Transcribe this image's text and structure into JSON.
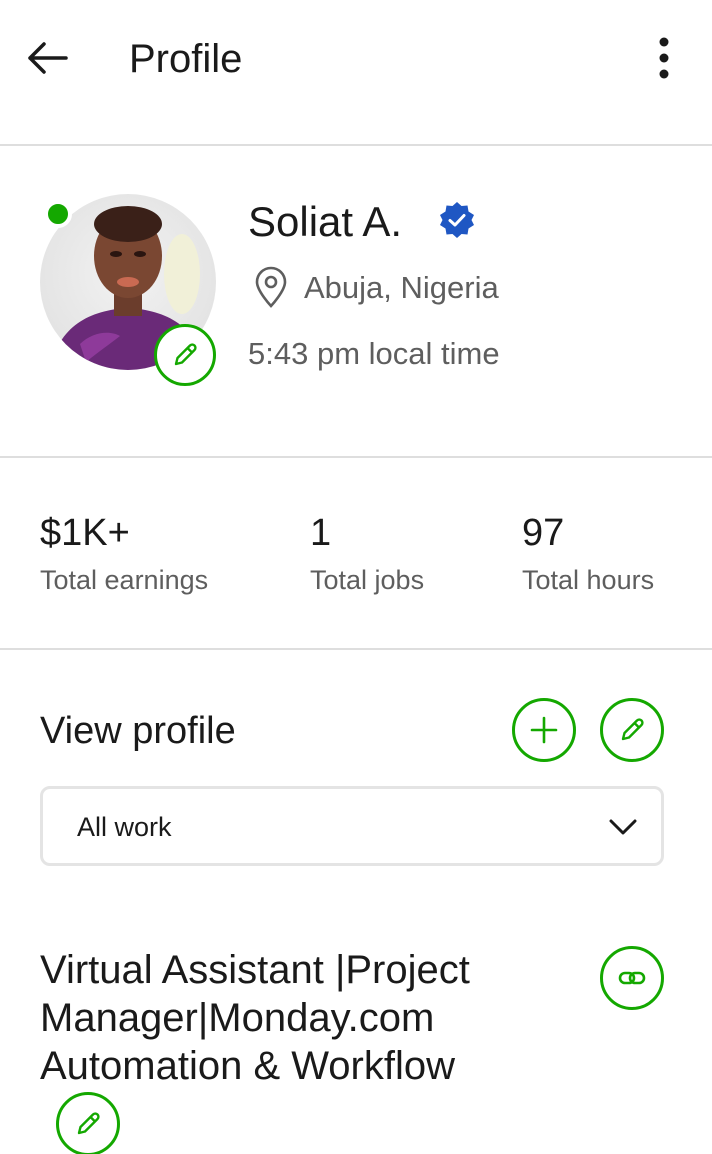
{
  "header": {
    "title": "Profile",
    "back_icon": "arrow-left-icon",
    "menu_icon": "more-vertical-icon"
  },
  "profile": {
    "name": "Soliat A.",
    "verified_icon": "verified-badge-icon",
    "location": "Abuja, Nigeria",
    "local_time": "5:43 pm local time",
    "online": true
  },
  "stats": [
    {
      "value": "$1K+",
      "label": "Total earnings"
    },
    {
      "value": "1",
      "label": "Total jobs"
    },
    {
      "value": "97",
      "label": "Total hours"
    }
  ],
  "view_profile": {
    "label": "View profile",
    "dropdown_value": "All work"
  },
  "headline": "Virtual Assistant |Project Manager|Monday.com Automation & Workflow",
  "colors": {
    "accent": "#14a800",
    "verified": "#1f57c3",
    "text": "#1a1a1a",
    "muted": "#5e5e5e",
    "divider": "#dedede"
  }
}
